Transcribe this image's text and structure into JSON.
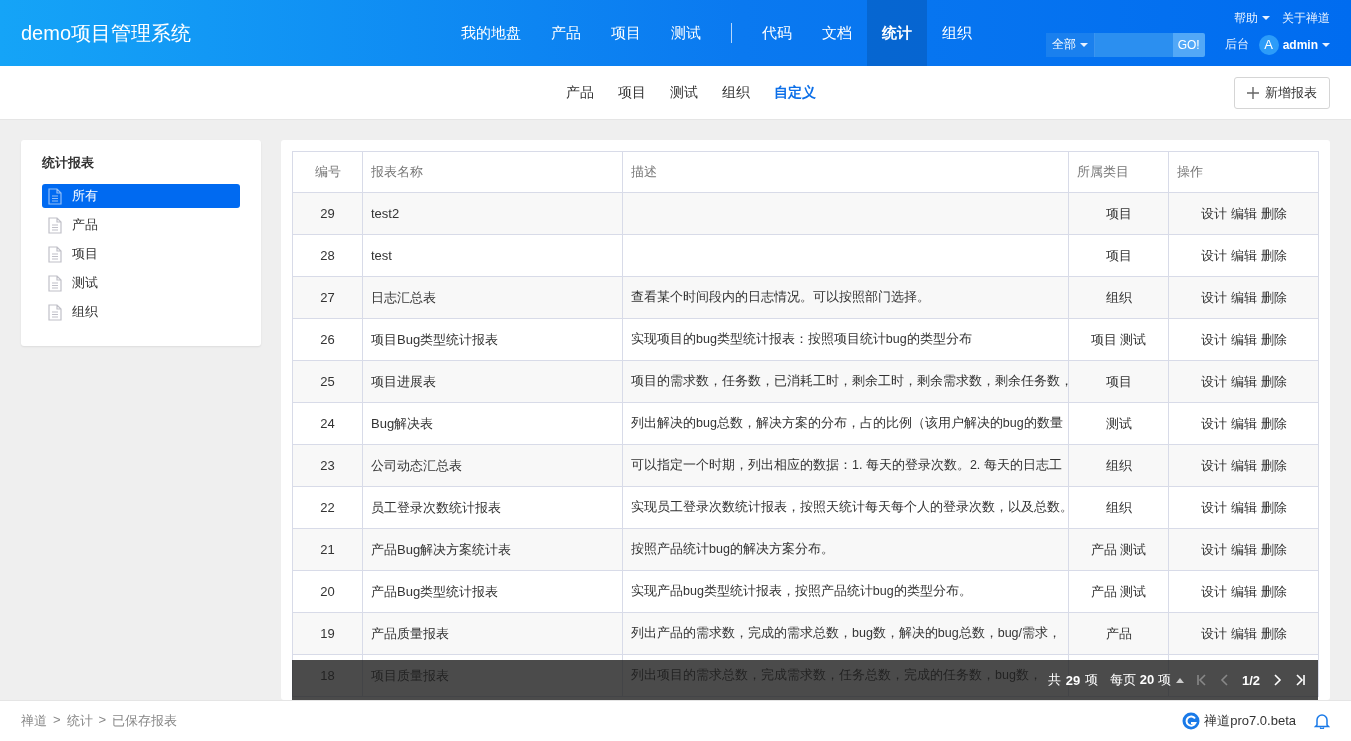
{
  "header": {
    "brand": "demo项目管理系统",
    "nav": [
      {
        "label": "我的地盘",
        "selected": false
      },
      {
        "label": "产品",
        "selected": false
      },
      {
        "label": "项目",
        "selected": false
      },
      {
        "label": "测试",
        "selected": false,
        "divider_after": true
      },
      {
        "label": "代码",
        "selected": false
      },
      {
        "label": "文档",
        "selected": false
      },
      {
        "label": "统计",
        "selected": true
      },
      {
        "label": "组织",
        "selected": false
      }
    ],
    "help": "帮助",
    "about": "关于禅道",
    "search_scope": "全部",
    "search_button": "GO!",
    "admin_link": "后台",
    "avatar": "A",
    "user": "admin"
  },
  "subnav": [
    {
      "label": "产品",
      "selected": false
    },
    {
      "label": "项目",
      "selected": false
    },
    {
      "label": "测试",
      "selected": false
    },
    {
      "label": "组织",
      "selected": false
    },
    {
      "label": "自定义",
      "selected": true
    }
  ],
  "add_button": "新增报表",
  "sidebar": {
    "title": "统计报表",
    "items": [
      {
        "label": "所有",
        "selected": true
      },
      {
        "label": "产品",
        "selected": false
      },
      {
        "label": "项目",
        "selected": false
      },
      {
        "label": "测试",
        "selected": false
      },
      {
        "label": "组织",
        "selected": false
      }
    ]
  },
  "table": {
    "columns": [
      "编号",
      "报表名称",
      "描述",
      "所属类目",
      "操作"
    ],
    "rows": [
      {
        "id": "29",
        "name": "test2",
        "category": "项目",
        "actions": [
          "设计",
          "编辑",
          "删除"
        ]
      },
      {
        "id": "28",
        "name": "test",
        "category": "项目",
        "actions": [
          "设计",
          "编辑",
          "删除"
        ]
      },
      {
        "id": "27",
        "name": "日志汇总表",
        "description": "查看某个时间段内的日志情况。可以按照部门选择。",
        "category": "组织",
        "actions": [
          "设计",
          "编辑",
          "删除"
        ]
      },
      {
        "id": "26",
        "name": "项目Bug类型统计报表",
        "description": "实现项目的bug类型统计报表：按照项目统计bug的类型分布",
        "category": "项目 测试",
        "actions": [
          "设计",
          "编辑",
          "删除"
        ]
      },
      {
        "id": "25",
        "name": "项目进展表",
        "description": "项目的需求数，任务数，已消耗工时，剩余工时，剩余需求数，剩余任务数，",
        "category": "项目",
        "actions": [
          "设计",
          "编辑",
          "删除"
        ]
      },
      {
        "id": "24",
        "name": "Bug解决表",
        "description": "列出解决的bug总数，解决方案的分布，占的比例（该用户解决的bug的数量",
        "category": "测试",
        "actions": [
          "设计",
          "编辑",
          "删除"
        ]
      },
      {
        "id": "23",
        "name": "公司动态汇总表",
        "description": "可以指定一个时期，列出相应的数据：1. 每天的登录次数。2. 每天的日志工",
        "category": "组织",
        "actions": [
          "设计",
          "编辑",
          "删除"
        ]
      },
      {
        "id": "22",
        "name": "员工登录次数统计报表",
        "description": "实现员工登录次数统计报表，按照天统计每天每个人的登录次数，以及总数。",
        "category": "组织",
        "actions": [
          "设计",
          "编辑",
          "删除"
        ]
      },
      {
        "id": "21",
        "name": "产品Bug解决方案统计表",
        "description": "按照产品统计bug的解决方案分布。",
        "category": "产品 测试",
        "actions": [
          "设计",
          "编辑",
          "删除"
        ]
      },
      {
        "id": "20",
        "name": "产品Bug类型统计报表",
        "description": "实现产品bug类型统计报表，按照产品统计bug的类型分布。",
        "category": "产品 测试",
        "actions": [
          "设计",
          "编辑",
          "删除"
        ]
      },
      {
        "id": "19",
        "name": "产品质量报表",
        "description": "列出产品的需求数，完成的需求总数，bug数，解决的bug总数，bug/需求，",
        "category": "产品",
        "actions": [
          "设计",
          "编辑",
          "删除"
        ]
      },
      {
        "id": "18",
        "name": "项目质量报表",
        "description": "列出项目的需求总数，完成需求数，任务总数，完成的任务数，bug数，"
      }
    ]
  },
  "pager": {
    "total": "共 **29** 项",
    "per_page": "每页 **20** 项",
    "page": "1/2"
  },
  "footer": {
    "breadcrumb": [
      "禅道",
      "统计",
      "已保存报表"
    ],
    "separator": ">",
    "version": "禅道pro7.0.beta"
  }
}
